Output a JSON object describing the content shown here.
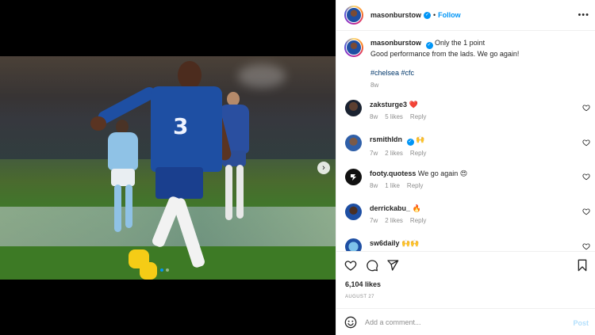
{
  "post": {
    "author": "masonburstow",
    "follow_label": "Follow",
    "separator": "•",
    "more_label": "•••",
    "caption_first": "Only the 1 point",
    "caption_second": "Good performance from the lads. We go again!",
    "hashtags": "#chelsea #cfc",
    "caption_age": "8w",
    "likes": "6,104 likes",
    "date": "AUGUST 27"
  },
  "media": {
    "next_arrow": "›",
    "carousel_count": 2,
    "carousel_active": 0,
    "shirt_number": "3"
  },
  "comments": [
    {
      "user": "zaksturge3",
      "text": "",
      "emoji": "❤️",
      "age": "8w",
      "likes": "5 likes",
      "reply": "Reply"
    },
    {
      "user": "rsmithldn",
      "verified": true,
      "text": "",
      "emoji": "🙌",
      "age": "7w",
      "likes": "2 likes",
      "reply": "Reply"
    },
    {
      "user": "footy.quotess",
      "text": "We go again",
      "emoji": "😍",
      "age": "8w",
      "likes": "1 like",
      "reply": "Reply"
    },
    {
      "user": "derrickabu_",
      "text": "",
      "emoji": "🔥",
      "age": "7w",
      "likes": "2 likes",
      "reply": "Reply"
    },
    {
      "user": "sw6daily",
      "text": "",
      "emoji": "🙌🙌",
      "age": "",
      "likes": "",
      "reply": ""
    }
  ],
  "add_comment": {
    "placeholder": "Add a comment...",
    "post_label": "Post"
  },
  "icons": {
    "heart": "heart-icon",
    "comment": "comment-icon",
    "share": "share-icon",
    "save": "bookmark-icon",
    "emoji": "emoji-icon"
  },
  "colors": {
    "accent": "#0095f6",
    "text": "#262626",
    "muted": "#8e8e8e",
    "post_disabled": "#b2dffc",
    "chelsea_blue": "#1e4fa3"
  }
}
